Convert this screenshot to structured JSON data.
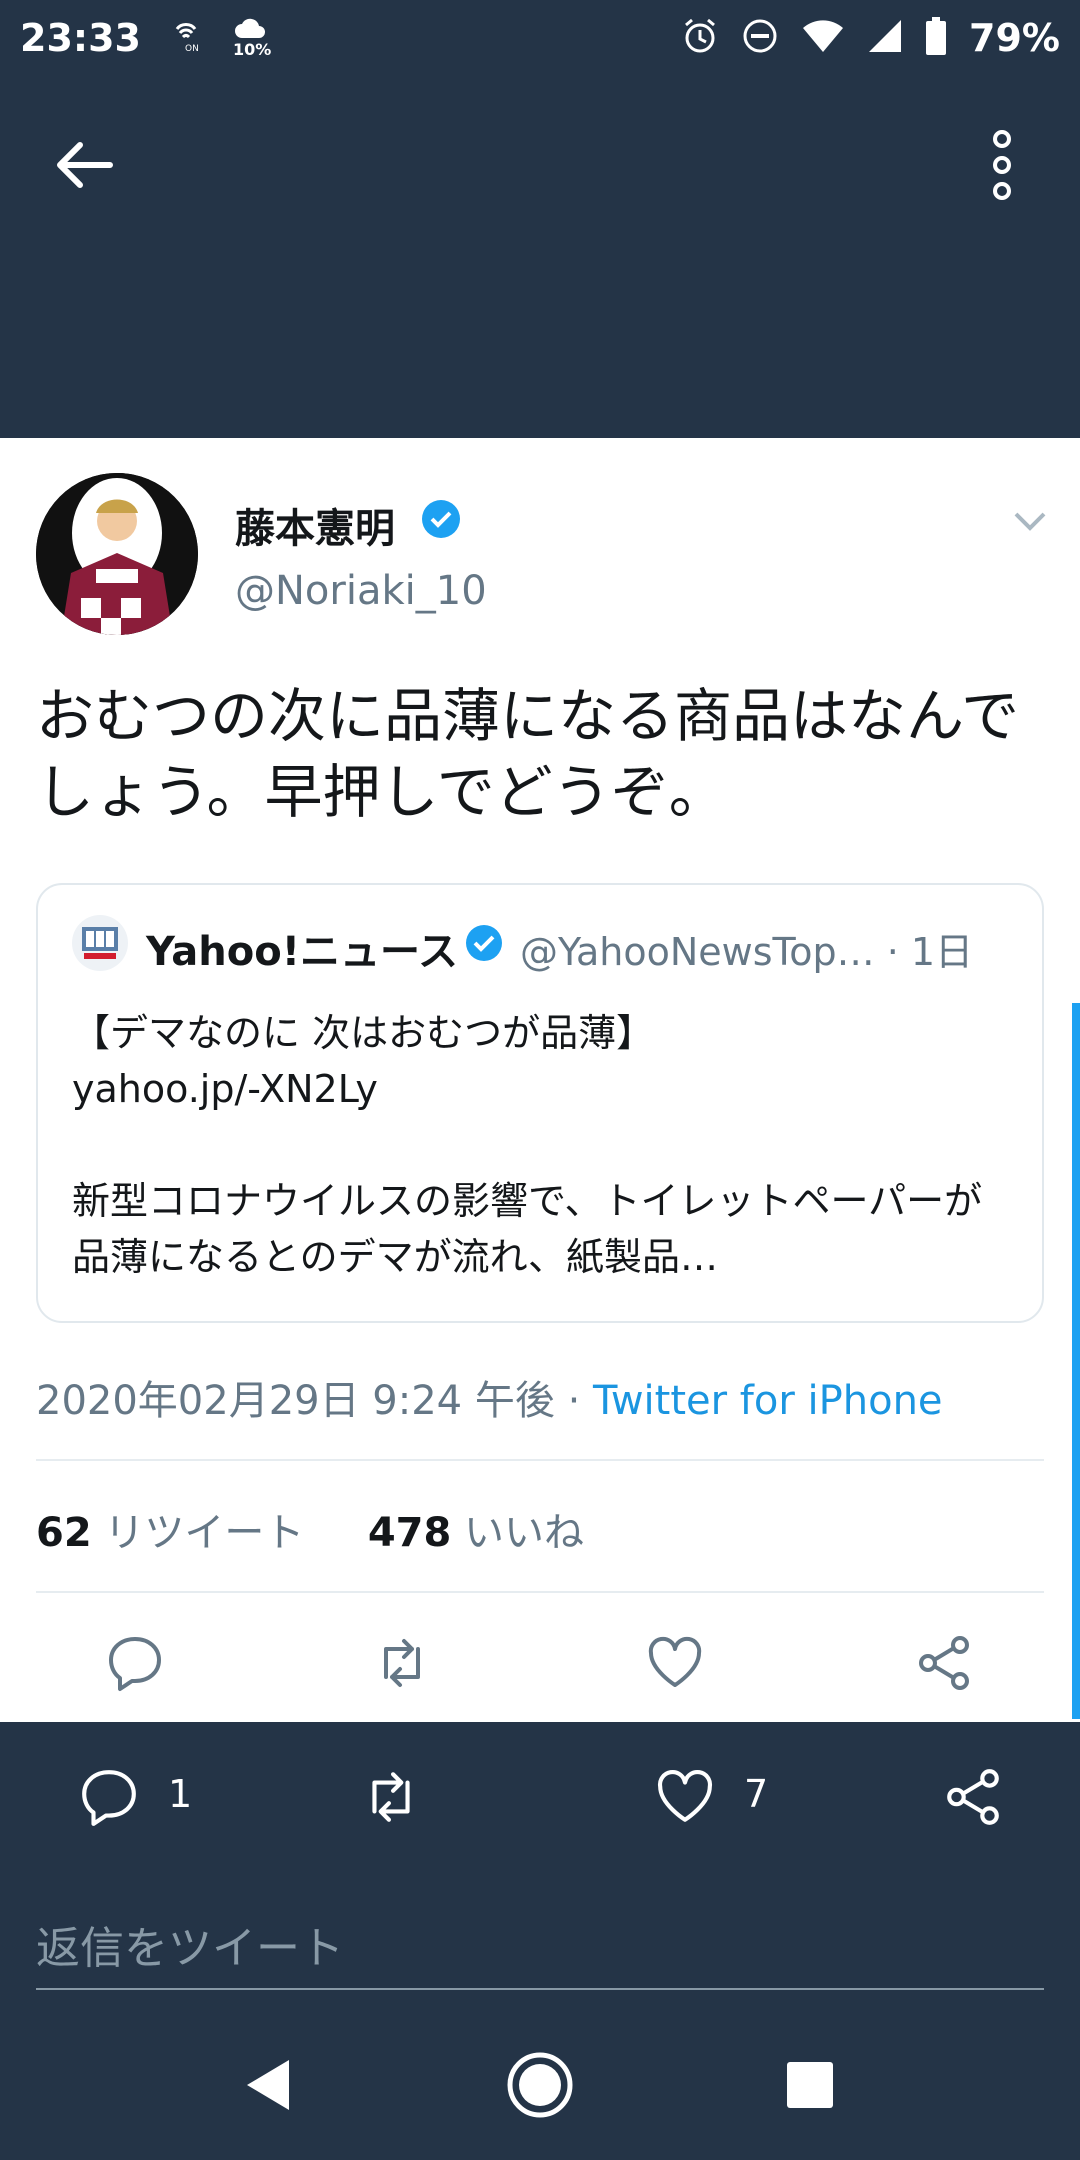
{
  "status_bar": {
    "time": "23:33",
    "battery": "79%",
    "icons": [
      "wifi-calling-icon",
      "weather-icon",
      "alarm-icon",
      "do-not-disturb-icon",
      "wifi-icon",
      "signal-icon",
      "battery-icon"
    ],
    "weather_text": "10%"
  },
  "app_bar": {
    "back_icon": "arrow-left-icon",
    "more_icon": "more-vertical-icon"
  },
  "tweet": {
    "author_name": "藤本憲明",
    "author_handle": "@Noriaki_10",
    "text": "おむつの次に品薄になる商品はなんでしょう。早押しでどうぞ。",
    "timestamp": "2020年02月29日 9:24 午後",
    "separator": " · ",
    "source": "Twitter for iPhone",
    "retweet_count": "62",
    "retweet_label": "リツイート",
    "like_count": "478",
    "like_label": "いいね"
  },
  "quote": {
    "name": "Yahoo!ニュース",
    "handle": "@YahooNewsTop…",
    "time": "· 1日",
    "body": "【デマなのに 次はおむつが品薄】\nyahoo.jp/-XN2Ly\n\n新型コロナウイルスの影響で、トイレットペーパーが品薄になるとのデマが流れ、紙製品…"
  },
  "reply_bar": {
    "reply_count": "1",
    "like_count": "7",
    "placeholder": "返信をツイート"
  },
  "colors": {
    "header_bg": "#243447",
    "accent": "#1da1f2",
    "secondary_text": "#657786"
  }
}
